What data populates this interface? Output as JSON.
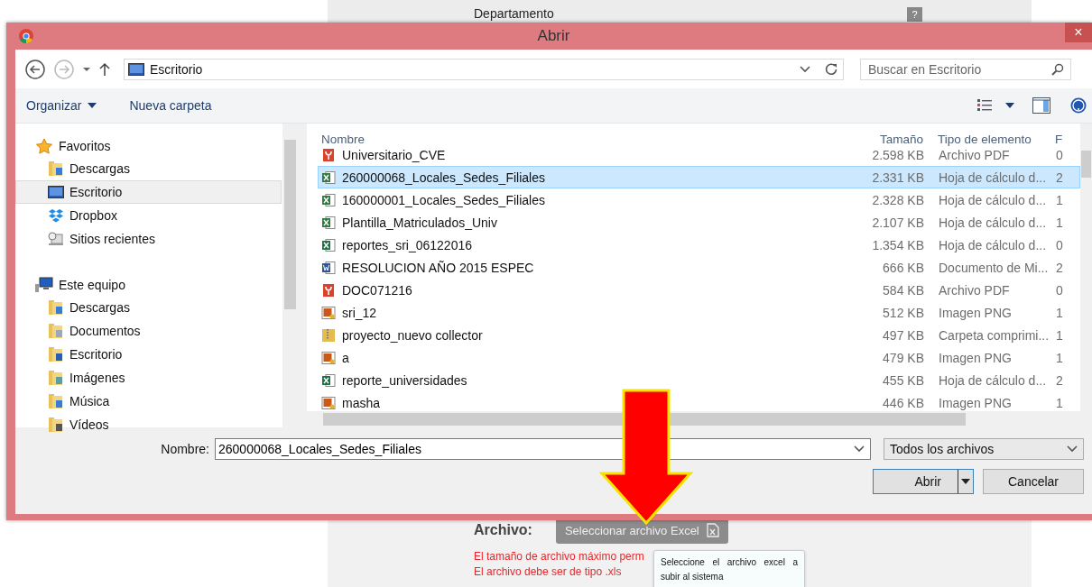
{
  "page": {
    "header": "Departamento",
    "help_mark": "?",
    "form_label": "Archivo:",
    "upload_button": "Seleccionar archivo Excel",
    "notes": [
      "El tamaño de archivo máximo perm",
      "El archivo debe ser de tipo .xls"
    ],
    "tooltip": "Seleccione el archivo excel a subir al sistema"
  },
  "window": {
    "title": "Abrir",
    "close": "×"
  },
  "address": {
    "location": "Escritorio",
    "search_placeholder": "Buscar en Escritorio"
  },
  "toolbar": [
    "Organizar",
    "Nueva carpeta"
  ],
  "sidebar": {
    "groups": [
      {
        "label": "Favoritos",
        "kind": "star",
        "children": [
          {
            "label": "Descargas",
            "kind": "downloads",
            "selected": false
          },
          {
            "label": "Escritorio",
            "kind": "desktop",
            "selected": true
          },
          {
            "label": "Dropbox",
            "kind": "dropbox",
            "selected": false
          },
          {
            "label": "Sitios recientes",
            "kind": "recent",
            "selected": false
          }
        ]
      },
      {
        "label": "Este equipo",
        "kind": "computer",
        "children": [
          {
            "label": "Descargas",
            "kind": "downloads",
            "selected": false
          },
          {
            "label": "Documentos",
            "kind": "documents",
            "selected": false
          },
          {
            "label": "Escritorio",
            "kind": "desktopfolder",
            "selected": false
          },
          {
            "label": "Imágenes",
            "kind": "pictures",
            "selected": false
          },
          {
            "label": "Música",
            "kind": "music",
            "selected": false
          },
          {
            "label": "Vídeos",
            "kind": "videos",
            "selected": false
          }
        ]
      }
    ]
  },
  "table": {
    "columns": [
      "Nombre",
      "Tamaño",
      "Tipo de elemento",
      "F"
    ],
    "rows": [
      {
        "kind": "pdf",
        "name": "Universitario_CVE",
        "size": "2.598 KB",
        "type": "Archivo PDF",
        "column_4": "0",
        "selected": false
      },
      {
        "kind": "excel",
        "name": "260000068_Locales_Sedes_Filiales",
        "size": "2.331 KB",
        "type": "Hoja de cálculo d...",
        "column_4": "2",
        "selected": true
      },
      {
        "kind": "excel",
        "name": "160000001_Locales_Sedes_Filiales",
        "size": "2.328 KB",
        "type": "Hoja de cálculo d...",
        "column_4": "1",
        "selected": false
      },
      {
        "kind": "excel",
        "name": "Plantilla_Matriculados_Univ",
        "size": "2.107 KB",
        "type": "Hoja de cálculo d...",
        "column_4": "1",
        "selected": false
      },
      {
        "kind": "excel2",
        "name": "reportes_sri_06122016",
        "size": "1.354 KB",
        "type": "Hoja de cálculo d...",
        "column_4": "0",
        "selected": false
      },
      {
        "kind": "word",
        "name": "RESOLUCION AÑO 2015 ESPEC",
        "size": "666 KB",
        "type": "Documento de Mi...",
        "column_4": "2",
        "selected": false
      },
      {
        "kind": "pdf",
        "name": "DOC071216",
        "size": "584 KB",
        "type": "Archivo PDF",
        "column_4": "0",
        "selected": false
      },
      {
        "kind": "png",
        "name": "sri_12",
        "size": "512 KB",
        "type": "Imagen PNG",
        "column_4": "1",
        "selected": false
      },
      {
        "kind": "zip",
        "name": "proyecto_nuevo collector",
        "size": "497 KB",
        "type": "Carpeta comprimi...",
        "column_4": "1",
        "selected": false
      },
      {
        "kind": "png",
        "name": "a",
        "size": "479 KB",
        "type": "Imagen PNG",
        "column_4": "1",
        "selected": false
      },
      {
        "kind": "excel2",
        "name": "reporte_universidades",
        "size": "455 KB",
        "type": "Hoja de cálculo d...",
        "column_4": "2",
        "selected": false
      },
      {
        "kind": "png",
        "name": "masha",
        "size": "446 KB",
        "type": "Imagen PNG",
        "column_4": "1",
        "selected": false
      }
    ]
  },
  "footer": {
    "name_label": "Nombre:",
    "name_value": "260000068_Locales_Sedes_Filiales",
    "filter": "Todos los archivos",
    "buttons": [
      "Abrir",
      "Cancelar"
    ]
  }
}
